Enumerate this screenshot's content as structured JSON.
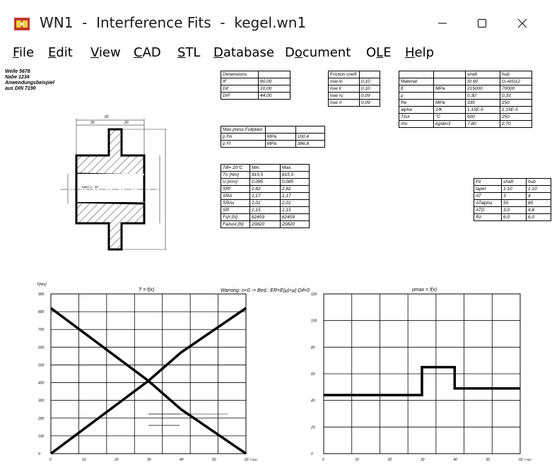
{
  "window": {
    "title": "WN1  -  Interference Fits  -  kegel.wn1"
  },
  "menu": [
    {
      "label": "File",
      "u": "F",
      "rest": "ile"
    },
    {
      "label": "Edit",
      "u": "E",
      "rest": "dit"
    },
    {
      "label": "View",
      "u": "V",
      "rest": "iew"
    },
    {
      "label": "CAD",
      "u": "C",
      "rest": "AD"
    },
    {
      "label": "STL",
      "u": "S",
      "rest": "TL"
    },
    {
      "label": "Database",
      "u": "D",
      "rest": "atabase"
    },
    {
      "label": "Document",
      "pre": "D",
      "u": "o",
      "rest": "cument"
    },
    {
      "label": "OLE",
      "pre": "O",
      "u": "L",
      "rest": "E"
    },
    {
      "label": "Help",
      "u": "H",
      "rest": "elp"
    }
  ],
  "header_note": [
    "Welle  5678",
    "Nabe  1234",
    "Anwendungsbeispiel",
    "aus DIN 7190"
  ],
  "dimensions": [
    [
      "Dimensions:",
      ""
    ],
    [
      "IF",
      "60,00"
    ],
    [
      "Dif",
      "10,00"
    ],
    [
      "DrF",
      "44,00"
    ]
  ],
  "friction": [
    [
      "Friction coeff.",
      ""
    ],
    [
      "nue lo",
      "0,10"
    ],
    [
      "nue ll",
      "0,10"
    ],
    [
      "nue ru",
      "0,09"
    ],
    [
      "nue rl",
      "0,09"
    ]
  ],
  "material": [
    [
      "",
      "",
      "shaft",
      "hub"
    ],
    [
      "Material",
      "",
      "St 60",
      "G-AlSi12"
    ],
    [
      "E",
      "MPa",
      "215000",
      "70000"
    ],
    [
      "μ",
      "",
      "0,30",
      "0,33"
    ],
    [
      "Re",
      "MPa",
      "335",
      "150"
    ],
    [
      "alpha",
      "1/K",
      "1,15E-5",
      "1,15E-5"
    ],
    [
      "Tzul",
      "°C",
      "600",
      "250"
    ],
    [
      "rho",
      "kg/dm3",
      "7,80",
      "2,70"
    ]
  ],
  "maxpress": [
    [
      "Max.press.Fullplast.",
      "",
      ""
    ],
    [
      "p FA",
      "MPa",
      "100,4"
    ],
    [
      "p Ft",
      "MPa",
      "386,8"
    ]
  ],
  "results": [
    [
      "TB= 20°C",
      "Min.",
      "Max."
    ],
    [
      "Tn [Nm]",
      "815,5",
      "815,5"
    ],
    [
      "U [mm]",
      "0,085",
      "0,085"
    ],
    [
      "SRf",
      "2,82",
      "2,82"
    ],
    [
      "SRA",
      "1,17",
      "1,17"
    ],
    [
      "SRAx",
      "2,01",
      "2,01"
    ],
    [
      "SR",
      "1,15",
      "1,15"
    ],
    [
      "Fsh [N]",
      "62459",
      "62459"
    ],
    [
      "Fazust [N]",
      "20820",
      "20820"
    ]
  ],
  "fit": [
    [
      "Fit",
      "shaft",
      "hub"
    ],
    [
      "taper",
      "1:10",
      "1:10"
    ],
    [
      "AT",
      "3",
      "4"
    ],
    [
      "ATalpha",
      "50",
      "80"
    ],
    [
      "ATD",
      "3,0",
      "4,8"
    ],
    [
      "Rz",
      "6,0",
      "6,0"
    ]
  ],
  "drawing": {
    "taper_label": "taper 1 : 10",
    "dim_top": "60",
    "dim_left": "30",
    "dim_right": "20"
  },
  "warning": "Warning: n<0 -> Bed.: ER=E(μ)+μ) Dif=0",
  "chart_data": [
    {
      "type": "line",
      "title": "T = f(x)",
      "ylabel": "T[Nm]",
      "xlabel": "l mm",
      "xlim": [
        0,
        60
      ],
      "ylim": [
        0,
        900
      ],
      "x_ticks": [
        0,
        10,
        20,
        30,
        40,
        50,
        60
      ],
      "y_ticks": [
        0,
        100,
        200,
        300,
        400,
        500,
        600,
        700,
        800,
        900
      ],
      "series": [
        {
          "values": [
            [
              0,
              820
            ],
            [
              30,
              410
            ],
            [
              40,
              250
            ],
            [
              60,
              0
            ]
          ]
        },
        {
          "values": [
            [
              0,
              0
            ],
            [
              30,
              410
            ],
            [
              40,
              570
            ],
            [
              60,
              820
            ]
          ]
        }
      ]
    },
    {
      "type": "line",
      "title": "pmax = f(x)",
      "xlabel": "l mm",
      "xlim": [
        0,
        60
      ],
      "ylim": [
        0,
        120
      ],
      "x_ticks": [
        0,
        10,
        20,
        30,
        40,
        50,
        60
      ],
      "y_ticks": [
        0,
        20,
        40,
        60,
        80,
        100,
        120
      ],
      "series": [
        {
          "values": [
            [
              0,
              44
            ],
            [
              30,
              44
            ],
            [
              30,
              65
            ],
            [
              40,
              65
            ],
            [
              40,
              49
            ],
            [
              60,
              49
            ]
          ]
        }
      ]
    }
  ]
}
